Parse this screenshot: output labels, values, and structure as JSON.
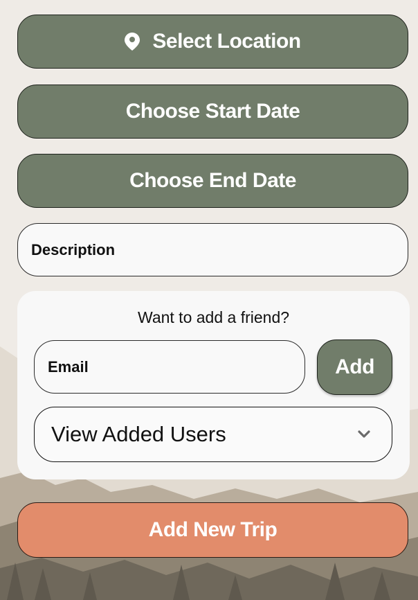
{
  "form": {
    "location_label": "Select Location",
    "start_date_label": "Choose Start Date",
    "end_date_label": "Choose End Date",
    "description_placeholder": "Description"
  },
  "friend_card": {
    "title": "Want to add a friend?",
    "email_placeholder": "Email",
    "add_label": "Add",
    "dropdown_label": "View Added Users"
  },
  "submit_label": "Add New Trip",
  "icons": {
    "location": "map-pin-icon",
    "dropdown": "chevron-down-icon"
  },
  "colors": {
    "primary_button": "#717d6a",
    "submit_button": "#e28c6b",
    "background": "#efebe6",
    "card": "#f8f8f8"
  }
}
